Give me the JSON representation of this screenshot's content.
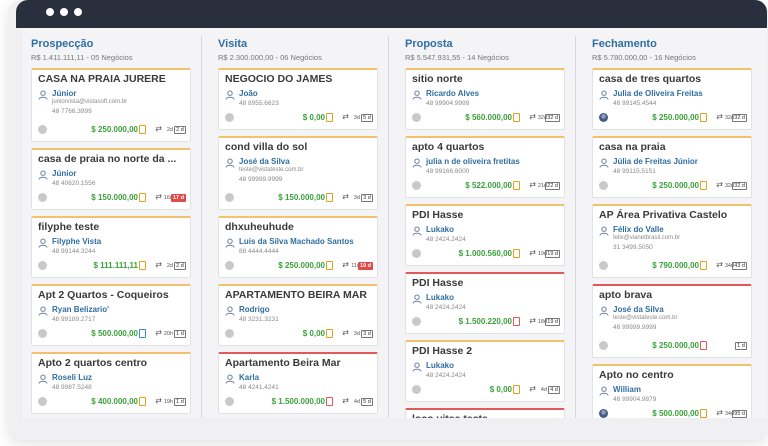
{
  "columns": [
    {
      "title": "Prospecção",
      "subtitle": "R$ 1.411.111,11 - 05 Negócios",
      "cards": [
        {
          "title": "CASA NA PRAIA JURERE",
          "contact": "Júnior",
          "email": "juniorvista@vistasoft.com.br",
          "phone": "48 7766.3999",
          "value": "$ 250.000,00",
          "days": "2d",
          "badge": "2 d",
          "badge_alert": false,
          "doc": "yellow",
          "top_red": false,
          "avatar": "gray"
        },
        {
          "title": "casa de praia no norte da ...",
          "contact": "Júnior",
          "email": "",
          "phone": "48 40620.1556",
          "value": "$ 150.000,00",
          "days": "16d",
          "badge": "17 d",
          "badge_alert": true,
          "doc": "yellow",
          "top_red": false,
          "avatar": "gray"
        },
        {
          "title": "filyphe teste",
          "contact": "Filyphe Vista",
          "email": "",
          "phone": "48 99144.3244",
          "value": "$ 111.111,11",
          "days": "2d",
          "badge": "2 d",
          "badge_alert": false,
          "doc": "yellow",
          "top_red": false,
          "avatar": "gray"
        },
        {
          "title": "Apt 2 Quartos - Coqueiros",
          "contact": "Ryan Belizario'",
          "email": "",
          "phone": "48 99189.2717",
          "value": "$ 500.000,00",
          "days": "20h",
          "badge": "1 d",
          "badge_alert": false,
          "doc": "blue",
          "top_red": false,
          "avatar": "gray"
        },
        {
          "title": "Apto 2 quartos centro",
          "contact": "Roseli Luz",
          "email": "",
          "phone": "48 9987.5248",
          "value": "$ 400.000,00",
          "days": "19h",
          "badge": "1 d",
          "badge_alert": false,
          "doc": "yellow",
          "top_red": false,
          "avatar": "gray"
        }
      ]
    },
    {
      "title": "Visita",
      "subtitle": "R$ 2.300.000,00 - 06 Negócios",
      "cards": [
        {
          "title": "NEGOCIO DO JAMES",
          "contact": "João",
          "email": "",
          "phone": "48 8955.6623",
          "value": "$ 0,00",
          "days": "3d",
          "badge": "5 d",
          "badge_alert": false,
          "doc": "yellow",
          "top_red": false,
          "avatar": "gray"
        },
        {
          "title": "cond villa do sol",
          "contact": "José da Silva",
          "email": "teste@vistateste.com.br",
          "phone": "48 99999.9999",
          "value": "$ 150.000,00",
          "days": "3d",
          "badge": "3 d",
          "badge_alert": false,
          "doc": "yellow",
          "top_red": false,
          "avatar": "gray"
        },
        {
          "title": "dhxuheuhude",
          "contact": "Luis da Silva Machado Santos",
          "email": "",
          "phone": "88 4444.4444",
          "value": "$ 250.000,00",
          "days": "11d",
          "badge": "19 d",
          "badge_alert": true,
          "doc": "yellow",
          "top_red": false,
          "avatar": "gray"
        },
        {
          "title": "APARTAMENTO BEIRA MAR",
          "contact": "Rodrigo",
          "email": "",
          "phone": "48 3231.3231",
          "value": "$ 0,00",
          "days": "3d",
          "badge": "3 d",
          "badge_alert": false,
          "doc": "yellow",
          "top_red": false,
          "avatar": "gray"
        },
        {
          "title": "Apartamento Beira Mar",
          "contact": "Karla",
          "email": "",
          "phone": "48 4241.4241",
          "value": "$ 1.500.000,00",
          "days": "4d",
          "badge": "5 d",
          "badge_alert": false,
          "doc": "red",
          "top_red": true,
          "avatar": "gray"
        }
      ]
    },
    {
      "title": "Proposta",
      "subtitle": "R$ 5.547.931,55 - 14 Negócios",
      "cards": [
        {
          "title": "sitio norte",
          "contact": "Ricardo Alves",
          "email": "",
          "phone": "48 99904.9999",
          "value": "$ 560.000,00",
          "days": "32d",
          "badge": "32 d",
          "badge_alert": false,
          "doc": "yellow",
          "top_red": false,
          "avatar": "gray"
        },
        {
          "title": "apto 4 quartos",
          "contact": "julia n de oliveira fretitas",
          "email": "",
          "phone": "48 99166.8000",
          "value": "$ 522.000,00",
          "days": "21d",
          "badge": "22 d",
          "badge_alert": false,
          "doc": "yellow",
          "top_red": false,
          "avatar": "gray"
        },
        {
          "title": "PDI Hasse",
          "contact": "Lukako",
          "email": "",
          "phone": "48 2424.2424",
          "value": "$ 1.000.560,00",
          "days": "19d",
          "badge": "19 d",
          "badge_alert": false,
          "doc": "yellow",
          "top_red": false,
          "avatar": "gray"
        },
        {
          "title": "PDI Hasse",
          "contact": "Lukako",
          "email": "",
          "phone": "48 2424.2424",
          "value": "$ 1.500.220,00",
          "days": "18d",
          "badge": "19 d",
          "badge_alert": false,
          "doc": "red",
          "top_red": true,
          "avatar": "gray"
        },
        {
          "title": "PDI Hasse 2",
          "contact": "Lukako",
          "email": "",
          "phone": "48 2424.2424",
          "value": "$ 0,00",
          "days": "4d",
          "badge": "4 d",
          "badge_alert": false,
          "doc": "yellow",
          "top_red": false,
          "avatar": "gray"
        },
        {
          "title": "loco vitae teste",
          "contact": "",
          "email": "",
          "phone": "",
          "value": "",
          "days": "",
          "badge": "",
          "badge_alert": false,
          "doc": "none",
          "top_red": true,
          "avatar": "none"
        }
      ]
    },
    {
      "title": "Fechamento",
      "subtitle": "R$ 5.780.000,00 - 16 Negócios",
      "cards": [
        {
          "title": "casa de tres quartos",
          "contact": "Julia de Oliveira Freitas",
          "email": "",
          "phone": "48 99145.4544",
          "value": "$ 250.000,00",
          "days": "32d",
          "badge": "32 d",
          "badge_alert": false,
          "doc": "yellow",
          "top_red": false,
          "avatar": "photo"
        },
        {
          "title": "casa na praia",
          "contact": "Júlia de Freitas Júnior",
          "email": "",
          "phone": "48 99115.5151",
          "value": "$ 250.000,00",
          "days": "32d",
          "badge": "32 d",
          "badge_alert": false,
          "doc": "yellow",
          "top_red": false,
          "avatar": "gray"
        },
        {
          "title": "AP Área Privativa Castelo",
          "contact": "Félix do Valle",
          "email": "felix@vianetbrasil.com.br",
          "phone": "31 3499.5050",
          "value": "$ 790.000,00",
          "days": "34d",
          "badge": "43 d",
          "badge_alert": false,
          "doc": "yellow",
          "top_red": false,
          "avatar": "gray"
        },
        {
          "title": "apto brava",
          "contact": "José da Silva",
          "email": "teste@vistateste.com.br",
          "phone": "48 99999.9999",
          "value": "$ 250.000,00",
          "days": "",
          "badge": "1 d",
          "badge_alert": false,
          "doc": "red",
          "top_red": true,
          "avatar": "gray"
        },
        {
          "title": "Apto no centro",
          "contact": "William",
          "email": "",
          "phone": "48 99904.9879",
          "value": "$ 500.000,00",
          "days": "34d",
          "badge": "95 d",
          "badge_alert": false,
          "doc": "yellow",
          "top_red": false,
          "avatar": "photo"
        }
      ]
    }
  ]
}
